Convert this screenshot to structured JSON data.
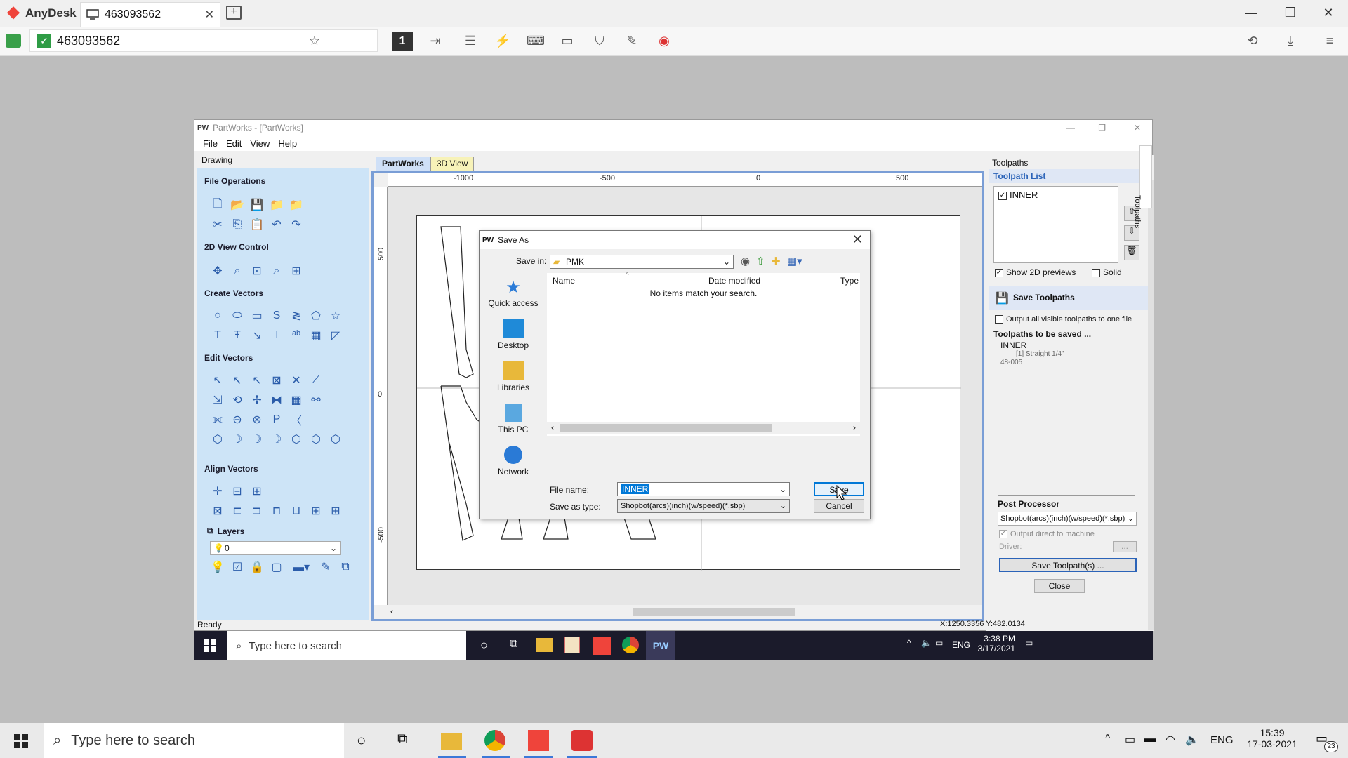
{
  "anydesk": {
    "app_name": "AnyDesk",
    "tab_label": "463093562",
    "address": "463093562",
    "display_number": "1"
  },
  "partworks": {
    "title": "PartWorks - [PartWorks]",
    "menu": [
      "File",
      "Edit",
      "View",
      "Help"
    ],
    "left_header": "Drawing",
    "sections": {
      "file_ops": "File Operations",
      "view_ctrl": "2D View Control",
      "create": "Create Vectors",
      "edit": "Edit Vectors",
      "align": "Align Vectors",
      "layers": "Layers"
    },
    "layer_value": "0",
    "tabs": [
      "PartWorks",
      "3D View"
    ],
    "ruler_top": [
      "-1000",
      "-500",
      "0",
      "500"
    ],
    "ruler_left": [
      "500",
      "0",
      "-500"
    ],
    "status": "Ready",
    "coords": "X:1250.3356 Y:482.0134"
  },
  "toolpaths": {
    "header": "Toolpaths",
    "list_title": "Toolpath List",
    "items": [
      "INNER"
    ],
    "show_2d": "Show 2D previews",
    "solid": "Solid",
    "save_title": "Save Toolpaths",
    "output_all": "Output all visible toolpaths to one file",
    "to_be_saved": "Toolpaths to be saved ...",
    "saved_name": "INNER",
    "saved_tool": "[1] Straight 1/4\"",
    "saved_code": "48-005",
    "post_processor": "Post Processor",
    "pp_value": "Shopbot(arcs)(inch)(w/speed)(*.sbp)",
    "output_direct": "Output direct to machine",
    "driver": "Driver:",
    "driver_btn": "...",
    "save_btn": "Save Toolpath(s) ...",
    "close_btn": "Close",
    "side_tab": "Toolpaths"
  },
  "dialog": {
    "title": "Save As",
    "save_in_label": "Save in:",
    "save_in_value": "PMK",
    "places": [
      "Quick access",
      "Desktop",
      "Libraries",
      "This PC",
      "Network"
    ],
    "col_name": "Name",
    "col_date": "Date modified",
    "col_type": "Type",
    "empty_msg": "No items match your search.",
    "file_name_label": "File name:",
    "file_name_value": "INNER",
    "save_type_label": "Save as type:",
    "save_type_value": "Shopbot(arcs)(inch)(w/speed)(*.sbp)",
    "save_btn": "Save",
    "cancel_btn": "Cancel"
  },
  "remote_taskbar": {
    "search": "Type here to search",
    "time": "3:38 PM",
    "date": "3/17/2021",
    "lang": "ENG"
  },
  "taskbar": {
    "search": "Type here to search",
    "time": "15:39",
    "date": "17-03-2021",
    "lang": "ENG",
    "notif_count": "23"
  }
}
